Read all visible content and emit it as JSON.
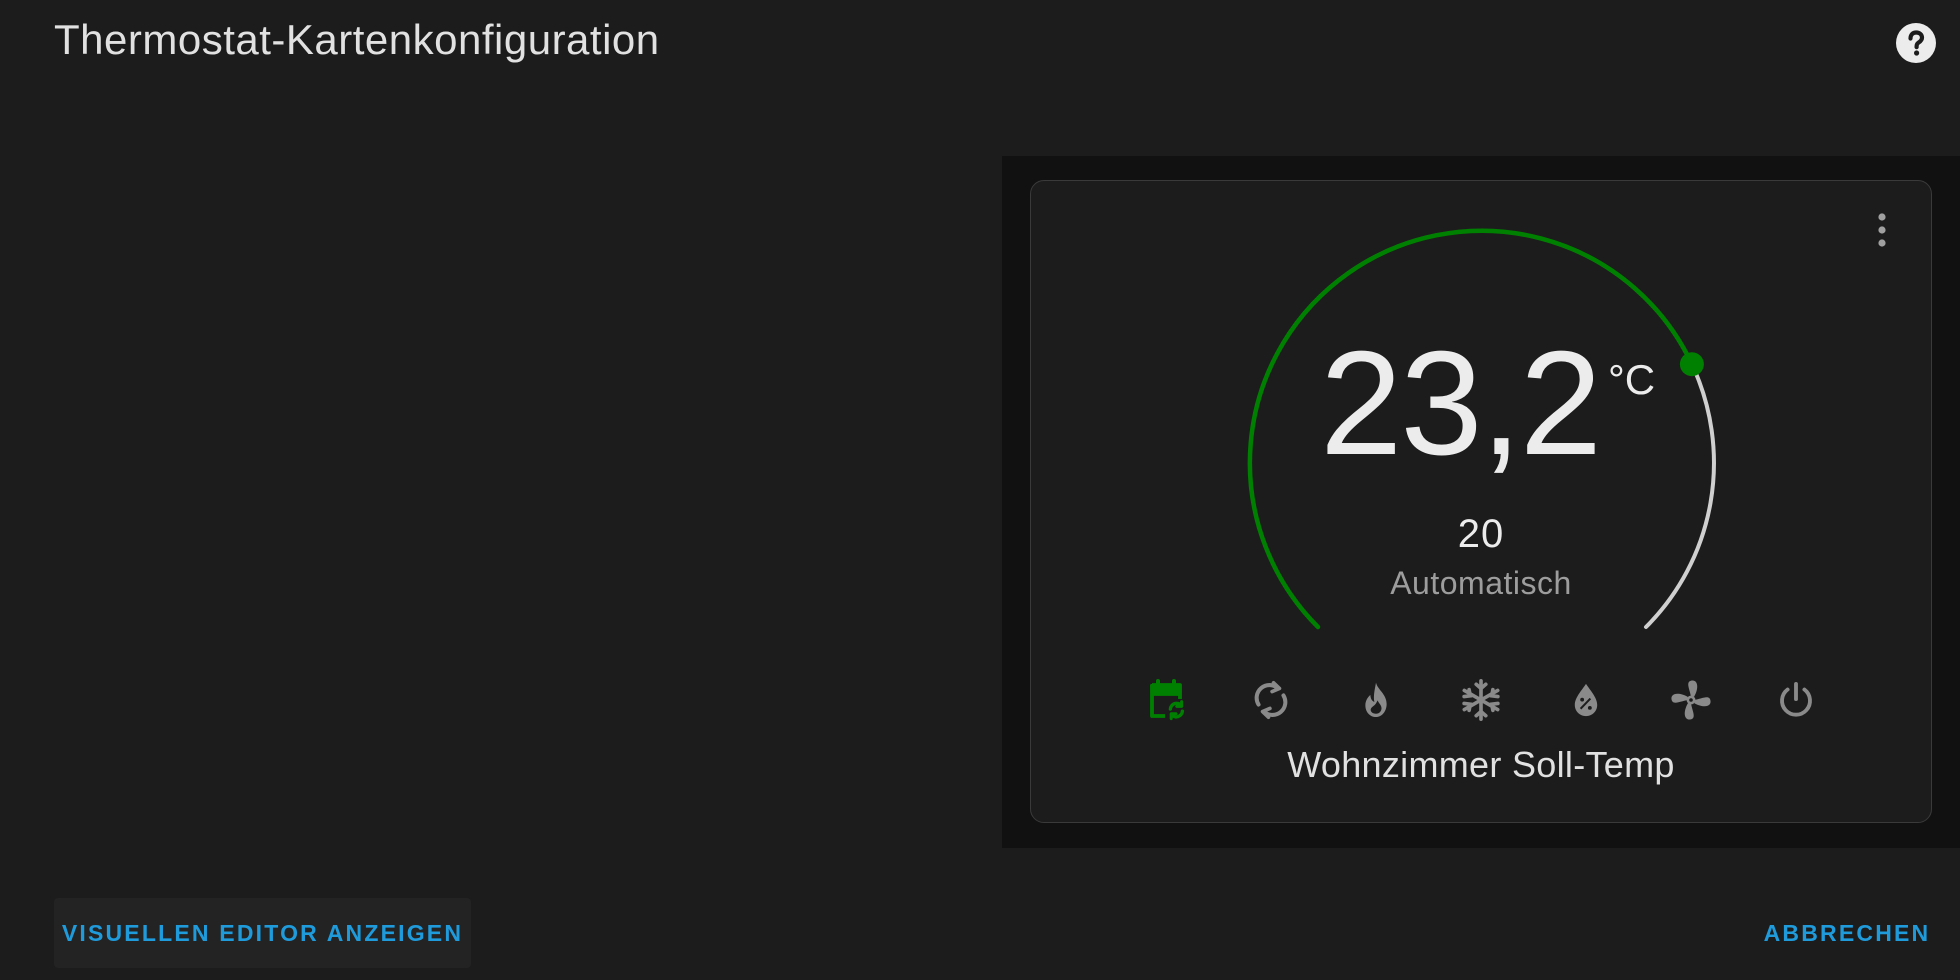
{
  "dialog": {
    "title": "Thermostat-Kartenkonfiguration",
    "help_icon": "help-circle-icon"
  },
  "card": {
    "menu_icon": "dots-vertical-icon",
    "current_temperature": "23,2",
    "unit": "°C",
    "target_temperature": "20",
    "hvac_action": "Automatisch",
    "name": "Wohnzimmer Soll-Temp",
    "dial_fraction": 0.74,
    "accent_color": "#008000",
    "track_color": "#d0d0d0",
    "modes": [
      {
        "icon": "calendar-sync-icon",
        "active": true
      },
      {
        "icon": "autorenew-icon",
        "active": false
      },
      {
        "icon": "fire-icon",
        "active": false
      },
      {
        "icon": "snowflake-icon",
        "active": false
      },
      {
        "icon": "water-percent-icon",
        "active": false
      },
      {
        "icon": "fan-icon",
        "active": false
      },
      {
        "icon": "power-icon",
        "active": false
      }
    ]
  },
  "actions": {
    "show_visual_editor": "VISUELLEN EDITOR ANZEIGEN",
    "cancel": "ABBRECHEN",
    "button_color": "#1f9bdc"
  }
}
